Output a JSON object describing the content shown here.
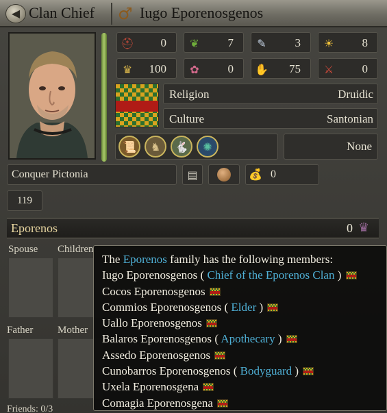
{
  "header": {
    "back_icon": "back-arrow-icon",
    "title": "Clan Chief",
    "gender_icon": "male-symbol-icon",
    "gender_glyph": "♂",
    "character_name": "Iugo Eporenosgenos"
  },
  "stats": [
    {
      "icon": "martial-helmet-icon",
      "glyph": "⛑",
      "value": "0"
    },
    {
      "icon": "laurel-wreath-icon",
      "glyph": "❦",
      "value": "7"
    },
    {
      "icon": "scroll-quill-icon",
      "glyph": "✎",
      "value": "3"
    },
    {
      "icon": "sun-icon",
      "glyph": "☀",
      "value": "8"
    },
    {
      "icon": "crown-icon",
      "glyph": "♛",
      "value": "100"
    },
    {
      "icon": "flowers-icon",
      "glyph": "✿",
      "value": "0"
    },
    {
      "icon": "hand-icon",
      "glyph": "✋",
      "value": "75"
    },
    {
      "icon": "dagger-icon",
      "glyph": "⚔",
      "value": "0"
    }
  ],
  "religion": {
    "label": "Religion",
    "value": "Druidic"
  },
  "culture": {
    "label": "Culture",
    "value": "Santonian"
  },
  "traits": [
    {
      "icon": "scroll-trait-icon",
      "glyph": "📜"
    },
    {
      "icon": "warrior-trait-icon",
      "glyph": "♞"
    },
    {
      "icon": "rabbit-trait-icon",
      "glyph": "🐇"
    },
    {
      "icon": "peacock-trait-icon",
      "glyph": "✺"
    }
  ],
  "none_text": "None",
  "ambition": "Conquer Pictonia",
  "gold": {
    "icon": "gold-pouch-icon",
    "glyph": "💰",
    "value": "0"
  },
  "age": "119",
  "family": {
    "name": "Eporenos",
    "prestige": "0",
    "prestige_icon": "prestige-icon"
  },
  "relations": {
    "spouse": "Spouse",
    "children": "Children",
    "father": "Father",
    "mother": "Mother",
    "friends": "Friends: 0/3"
  },
  "tooltip": {
    "intro_prefix": "The ",
    "family": "Eporenos",
    "intro_suffix": " family has the following members:",
    "members": [
      {
        "name": "Iugo Eporenosgenos",
        "title": "Chief of the Eporenos Clan"
      },
      {
        "name": "Cocos Eporenosgenos",
        "title": ""
      },
      {
        "name": "Commios Eporenosgenos",
        "title": "Elder"
      },
      {
        "name": "Uallo Eporenosgenos",
        "title": ""
      },
      {
        "name": "Balaros Eporenosgenos",
        "title": "Apothecary"
      },
      {
        "name": "Assedo Eporenosgenos",
        "title": ""
      },
      {
        "name": "Cunobarros Eporenosgenos",
        "title": "Bodyguard"
      },
      {
        "name": "Uxela Eporenosgena",
        "title": ""
      },
      {
        "name": "Comagia Eporenosgena",
        "title": ""
      }
    ]
  },
  "colors": {
    "highlight": "#4fb0d6",
    "coa_green": "#2c6f2e",
    "coa_gold": "#d8a31f",
    "coa_red": "#b01b16"
  }
}
